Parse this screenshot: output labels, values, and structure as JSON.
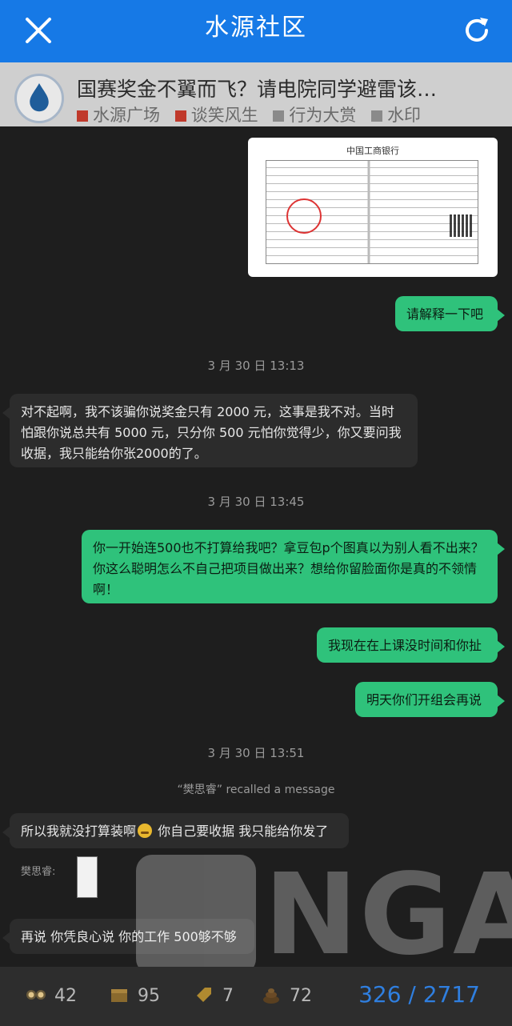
{
  "topbar": {
    "title": "水源社区"
  },
  "thread": {
    "title": "国赛奖金不翼而飞？请电院同学避雷该…",
    "tags": [
      "水源广场",
      "谈笑风生",
      "行为大赏",
      "水印"
    ],
    "tag_colors": [
      "#c0392b",
      "#c0392b",
      "#8a8a8a",
      "#8a8a8a"
    ]
  },
  "receipt": {
    "title": "中国工商银行"
  },
  "messages": {
    "m1": "请解释一下吧",
    "ts1": "3 月 30 日 13:13",
    "m2": "对不起啊，我不该骗你说奖金只有 2000 元，这事是我不对。当时怕跟你说总共有 5000 元，只分你 500 元怕你觉得少，你又要问我收据，我只能给你张2000的了。",
    "ts2": "3 月 30 日 13:45",
    "m3": "你一开始连500也不打算给我吧？拿豆包p个图真以为别人看不出来？你这么聪明怎么不自己把项目做出来？想给你留脸面你是真的不领情啊！",
    "m4": "我现在在上课没时间和你扯",
    "m5": "明天你们开组会再说",
    "ts3": "3 月 30 日 13:51",
    "recall_name": "“樊思睿”",
    "recall_text": " recalled a message",
    "m6a": "所以我就没打算装啊",
    "m6b": " 你自己要收据  我只能给你发了",
    "quote_name": "樊思睿:",
    "m7": "再说 你凭良心说 你的工作 500够不够"
  },
  "watermark": {
    "text": "NGA"
  },
  "bottombar": {
    "stats": [
      "42",
      "95",
      "7",
      "72"
    ],
    "pager": "326 / 2717"
  }
}
